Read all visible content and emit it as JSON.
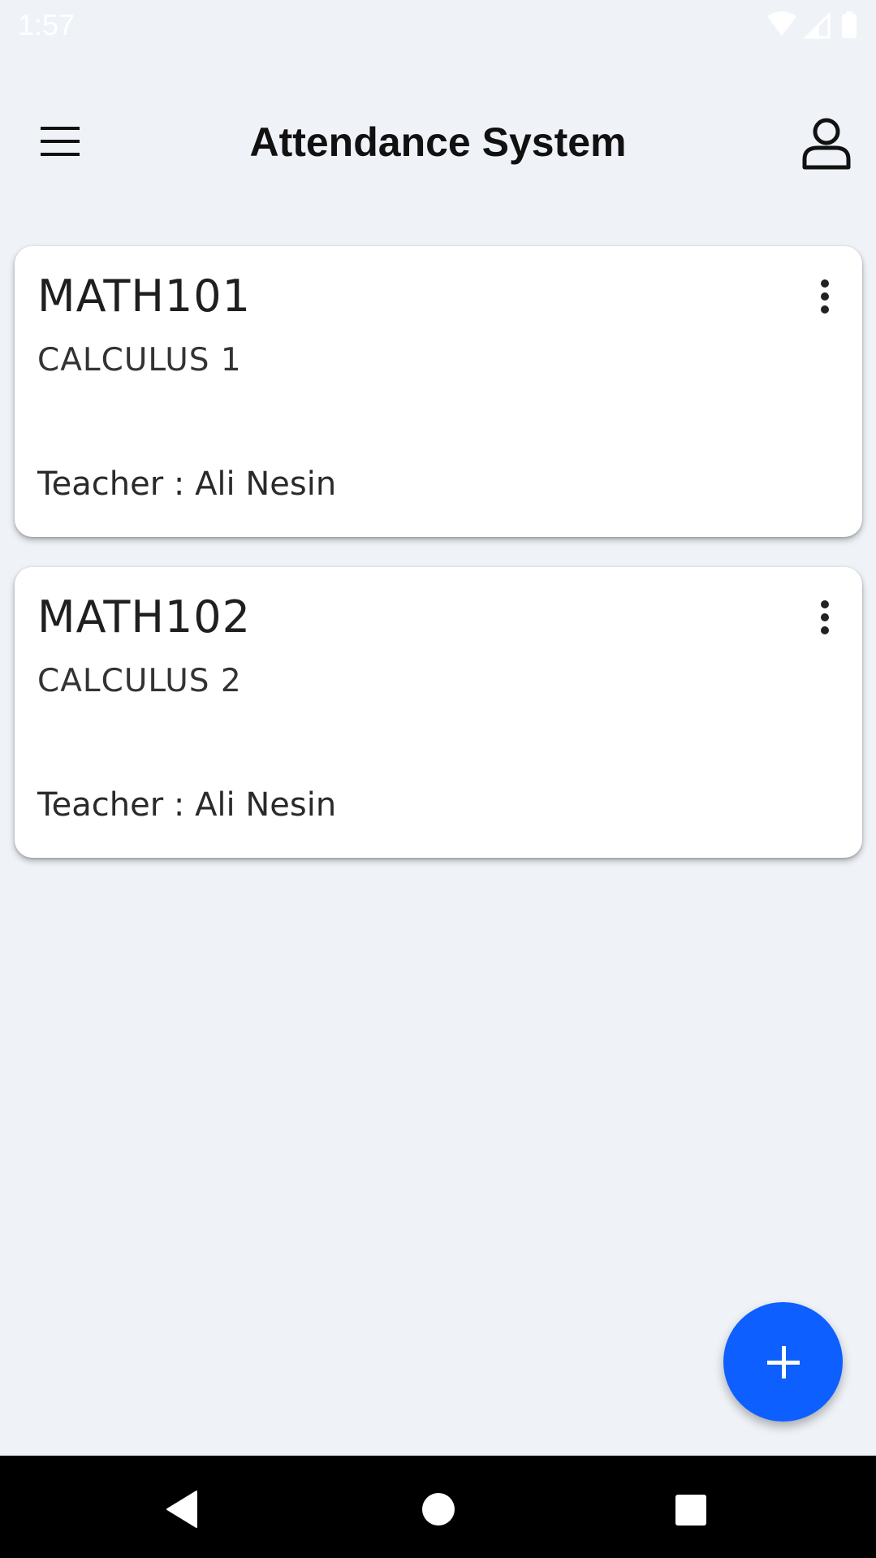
{
  "status_bar": {
    "time": "1:57",
    "icons": [
      "wifi-icon",
      "cell-signal-icon",
      "battery-icon"
    ]
  },
  "app_bar": {
    "title": "Attendance System",
    "menu_icon": "hamburger-menu-icon",
    "profile_icon": "person-icon"
  },
  "courses": [
    {
      "code": "MATH101",
      "name": "CALCULUS 1",
      "teacher": "Teacher : Ali Nesin"
    },
    {
      "code": "MATH102",
      "name": "CALCULUS 2",
      "teacher": "Teacher : Ali Nesin"
    }
  ],
  "fab": {
    "icon": "plus-icon",
    "color": "#0d5fff"
  },
  "nav_bar": {
    "icons": [
      "back-triangle-icon",
      "home-circle-icon",
      "recents-square-icon"
    ]
  },
  "colors": {
    "background": "#eff3f8",
    "card": "#ffffff",
    "accent": "#0d5fff"
  }
}
